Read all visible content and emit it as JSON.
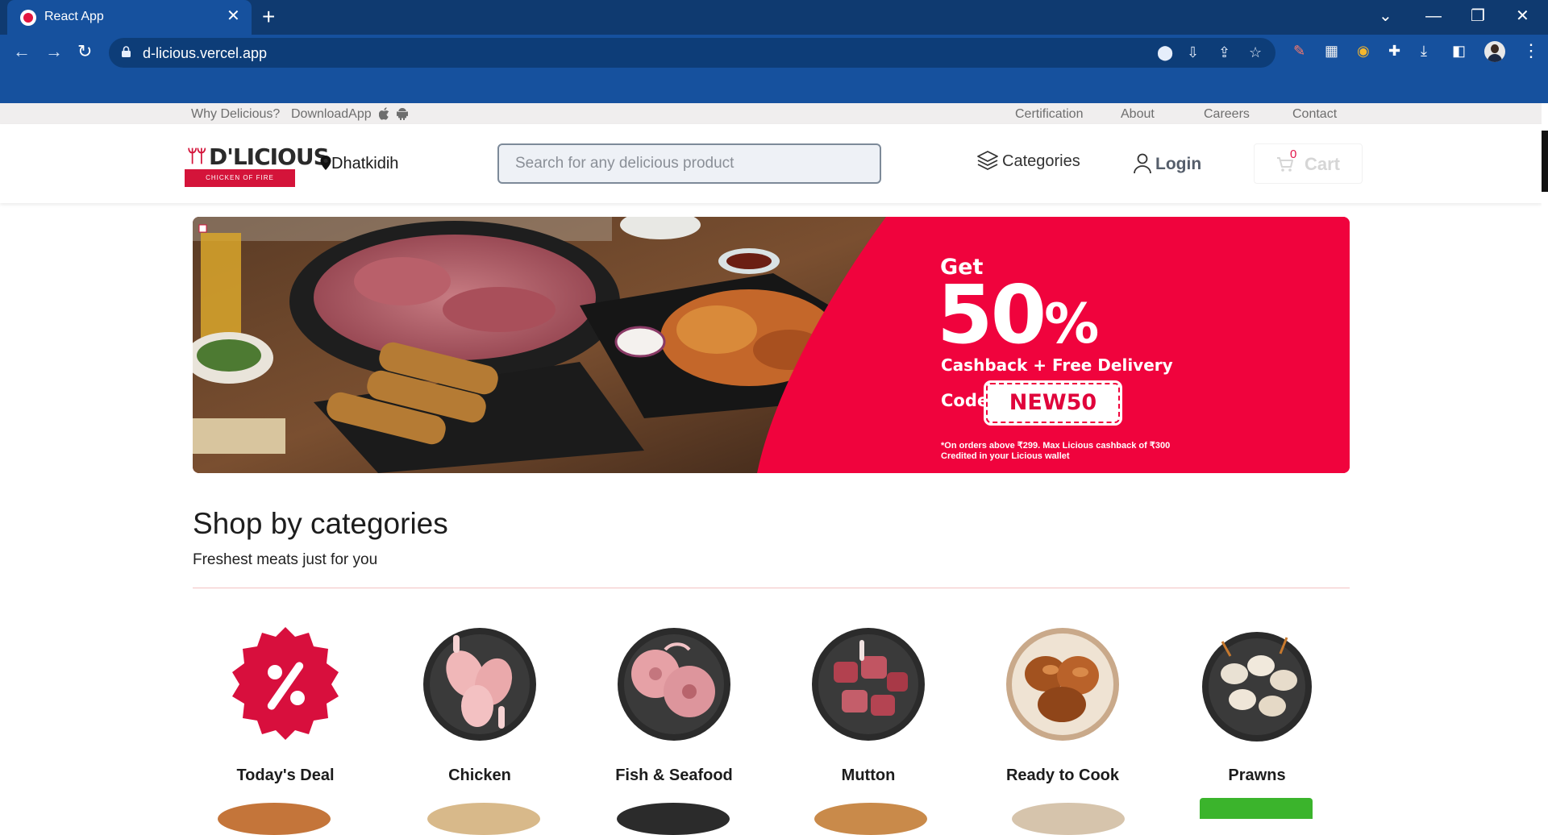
{
  "browser": {
    "tab_title": "React App",
    "url": "d-licious.vercel.app"
  },
  "topbar": {
    "left_links": [
      "Why Delicious?",
      "DownloadApp"
    ],
    "right_links": [
      "Certification",
      "About",
      "Careers",
      "Contact"
    ]
  },
  "header": {
    "logo_text": "D'LICIOUS",
    "logo_tagline": "CHICKEN OF FIRE",
    "location": "Dhatkidih",
    "search_placeholder": "Search for any delicious product",
    "categories_label": "Categories",
    "login_label": "Login",
    "cart_label": "Cart",
    "cart_count": "0"
  },
  "banner": {
    "get": "Get",
    "percent": "50",
    "percent_sign": "%",
    "cashback": "Cashback + Free Delivery",
    "code_label": "Code",
    "code": "NEW50",
    "note_line1": "*On orders above ₹299. Max Licious cashback of ₹300",
    "note_line2": "Credited in your Licious wallet"
  },
  "section": {
    "title": "Shop by categories",
    "subtitle": "Freshest meats just for you"
  },
  "categories": [
    {
      "label": "Today's Deal"
    },
    {
      "label": "Chicken"
    },
    {
      "label": "Fish & Seafood"
    },
    {
      "label": "Mutton"
    },
    {
      "label": "Ready to Cook"
    },
    {
      "label": "Prawns"
    }
  ],
  "colors": {
    "brand_red": "#d4143a",
    "banner_red": "#f0033d",
    "chrome_blue": "#16519e"
  }
}
